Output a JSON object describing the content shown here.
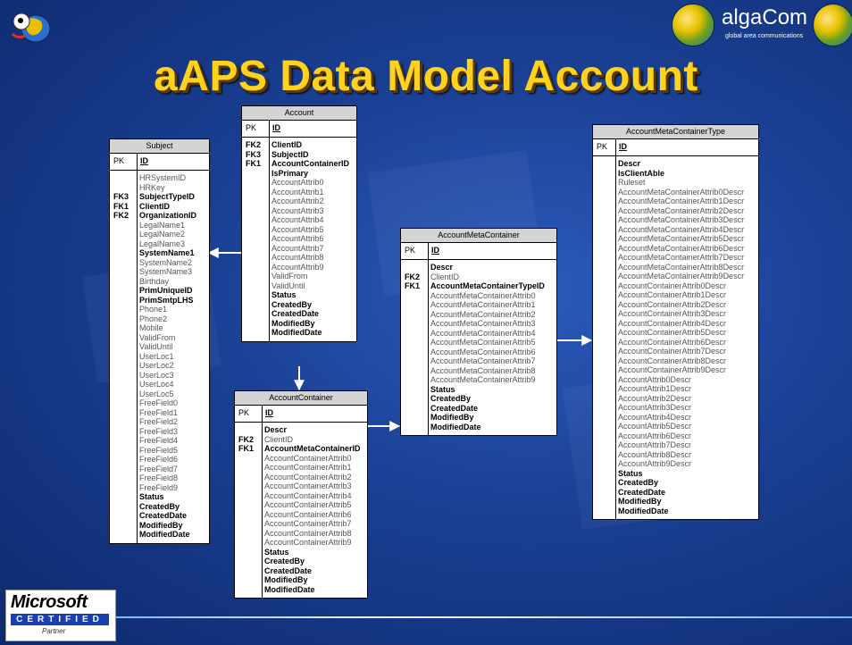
{
  "slide": {
    "title": "aAPS Data Model Account",
    "brand": {
      "name": "algaCom",
      "tagline": "global area communications"
    },
    "logo": {
      "word": "Microsoft",
      "certified": "CERTIFIED",
      "partner": "Partner"
    }
  },
  "tables": {
    "subject": {
      "name": "Subject",
      "pk_label": "PK",
      "pk_field": "ID",
      "fields": [
        {
          "key": "",
          "name": "HRSystemID",
          "bold": false
        },
        {
          "key": "",
          "name": "HRKey",
          "bold": false
        },
        {
          "key": "FK3",
          "name": "SubjectTypeID",
          "bold": true
        },
        {
          "key": "FK1",
          "name": "ClientID",
          "bold": true
        },
        {
          "key": "FK2",
          "name": "OrganizationID",
          "bold": true
        },
        {
          "key": "",
          "name": "LegalName1",
          "bold": false
        },
        {
          "key": "",
          "name": "LegalName2",
          "bold": false
        },
        {
          "key": "",
          "name": "LegalName3",
          "bold": false
        },
        {
          "key": "",
          "name": "SystemName1",
          "bold": true
        },
        {
          "key": "",
          "name": "SystemName2",
          "bold": false
        },
        {
          "key": "",
          "name": "SystemName3",
          "bold": false
        },
        {
          "key": "",
          "name": "Birthday",
          "bold": false
        },
        {
          "key": "",
          "name": "PrimUniqueID",
          "bold": true
        },
        {
          "key": "",
          "name": "PrimSmtpLHS",
          "bold": true
        },
        {
          "key": "",
          "name": "Phone1",
          "bold": false
        },
        {
          "key": "",
          "name": "Phone2",
          "bold": false
        },
        {
          "key": "",
          "name": "Mobile",
          "bold": false
        },
        {
          "key": "",
          "name": "ValidFrom",
          "bold": false
        },
        {
          "key": "",
          "name": "ValidUntil",
          "bold": false
        },
        {
          "key": "",
          "name": "UserLoc1",
          "bold": false
        },
        {
          "key": "",
          "name": "UserLoc2",
          "bold": false
        },
        {
          "key": "",
          "name": "UserLoc3",
          "bold": false
        },
        {
          "key": "",
          "name": "UserLoc4",
          "bold": false
        },
        {
          "key": "",
          "name": "UserLoc5",
          "bold": false
        },
        {
          "key": "",
          "name": "FreeField0",
          "bold": false
        },
        {
          "key": "",
          "name": "FreeField1",
          "bold": false
        },
        {
          "key": "",
          "name": "FreeField2",
          "bold": false
        },
        {
          "key": "",
          "name": "FreeField3",
          "bold": false
        },
        {
          "key": "",
          "name": "FreeField4",
          "bold": false
        },
        {
          "key": "",
          "name": "FreeField5",
          "bold": false
        },
        {
          "key": "",
          "name": "FreeField6",
          "bold": false
        },
        {
          "key": "",
          "name": "FreeField7",
          "bold": false
        },
        {
          "key": "",
          "name": "FreeField8",
          "bold": false
        },
        {
          "key": "",
          "name": "FreeField9",
          "bold": false
        },
        {
          "key": "",
          "name": "Status",
          "bold": true
        },
        {
          "key": "",
          "name": "CreatedBy",
          "bold": true
        },
        {
          "key": "",
          "name": "CreatedDate",
          "bold": true
        },
        {
          "key": "",
          "name": "ModifiedBy",
          "bold": true
        },
        {
          "key": "",
          "name": "ModifiedDate",
          "bold": true
        }
      ]
    },
    "account": {
      "name": "Account",
      "pk_label": "PK",
      "pk_field": "ID",
      "fields": [
        {
          "key": "FK2",
          "name": "ClientID",
          "bold": true
        },
        {
          "key": "FK3",
          "name": "SubjectID",
          "bold": true
        },
        {
          "key": "FK1",
          "name": "AccountContainerID",
          "bold": true
        },
        {
          "key": "",
          "name": "IsPrimary",
          "bold": true
        },
        {
          "key": "",
          "name": "AccountAttrib0",
          "bold": false
        },
        {
          "key": "",
          "name": "AccountAttrib1",
          "bold": false
        },
        {
          "key": "",
          "name": "AccountAttrib2",
          "bold": false
        },
        {
          "key": "",
          "name": "AccountAttrib3",
          "bold": false
        },
        {
          "key": "",
          "name": "AccountAttrib4",
          "bold": false
        },
        {
          "key": "",
          "name": "AccountAttrib5",
          "bold": false
        },
        {
          "key": "",
          "name": "AccountAttrib6",
          "bold": false
        },
        {
          "key": "",
          "name": "AccountAttrib7",
          "bold": false
        },
        {
          "key": "",
          "name": "AccountAttrib8",
          "bold": false
        },
        {
          "key": "",
          "name": "AccountAttrib9",
          "bold": false
        },
        {
          "key": "",
          "name": "ValidFrom",
          "bold": false
        },
        {
          "key": "",
          "name": "ValidUntil",
          "bold": false
        },
        {
          "key": "",
          "name": "Status",
          "bold": true
        },
        {
          "key": "",
          "name": "CreatedBy",
          "bold": true
        },
        {
          "key": "",
          "name": "CreatedDate",
          "bold": true
        },
        {
          "key": "",
          "name": "ModifiedBy",
          "bold": true
        },
        {
          "key": "",
          "name": "ModifiedDate",
          "bold": true
        }
      ]
    },
    "account_container": {
      "name": "AccountContainer",
      "pk_label": "PK",
      "pk_field": "ID",
      "fields": [
        {
          "key": "",
          "name": "Descr",
          "bold": true
        },
        {
          "key": "FK2",
          "name": "ClientID",
          "bold": false
        },
        {
          "key": "FK1",
          "name": "AccountMetaContainerID",
          "bold": true
        },
        {
          "key": "",
          "name": "AccountContainerAttrib0",
          "bold": false
        },
        {
          "key": "",
          "name": "AccountContainerAttrib1",
          "bold": false
        },
        {
          "key": "",
          "name": "AccountContainerAttrib2",
          "bold": false
        },
        {
          "key": "",
          "name": "AccountContainerAttrib3",
          "bold": false
        },
        {
          "key": "",
          "name": "AccountContainerAttrib4",
          "bold": false
        },
        {
          "key": "",
          "name": "AccountContainerAttrib5",
          "bold": false
        },
        {
          "key": "",
          "name": "AccountContainerAttrib6",
          "bold": false
        },
        {
          "key": "",
          "name": "AccountContainerAttrib7",
          "bold": false
        },
        {
          "key": "",
          "name": "AccountContainerAttrib8",
          "bold": false
        },
        {
          "key": "",
          "name": "AccountContainerAttrib9",
          "bold": false
        },
        {
          "key": "",
          "name": "Status",
          "bold": true
        },
        {
          "key": "",
          "name": "CreatedBy",
          "bold": true
        },
        {
          "key": "",
          "name": "CreatedDate",
          "bold": true
        },
        {
          "key": "",
          "name": "ModifiedBy",
          "bold": true
        },
        {
          "key": "",
          "name": "ModifiedDate",
          "bold": true
        }
      ]
    },
    "account_meta_container": {
      "name": "AccountMetaContainer",
      "pk_label": "PK",
      "pk_field": "ID",
      "fields": [
        {
          "key": "",
          "name": "Descr",
          "bold": true
        },
        {
          "key": "FK2",
          "name": "ClientID",
          "bold": false
        },
        {
          "key": "FK1",
          "name": "AccountMetaContainerTypeID",
          "bold": true
        },
        {
          "key": "",
          "name": "AccountMetaContainerAttrib0",
          "bold": false
        },
        {
          "key": "",
          "name": "AccountMetaContainerAttrib1",
          "bold": false
        },
        {
          "key": "",
          "name": "AccountMetaContainerAttrib2",
          "bold": false
        },
        {
          "key": "",
          "name": "AccountMetaContainerAttrib3",
          "bold": false
        },
        {
          "key": "",
          "name": "AccountMetaContainerAttrib4",
          "bold": false
        },
        {
          "key": "",
          "name": "AccountMetaContainerAttrib5",
          "bold": false
        },
        {
          "key": "",
          "name": "AccountMetaContainerAttrib6",
          "bold": false
        },
        {
          "key": "",
          "name": "AccountMetaContainerAttrib7",
          "bold": false
        },
        {
          "key": "",
          "name": "AccountMetaContainerAttrib8",
          "bold": false
        },
        {
          "key": "",
          "name": "AccountMetaContainerAttrib9",
          "bold": false
        },
        {
          "key": "",
          "name": "Status",
          "bold": true
        },
        {
          "key": "",
          "name": "CreatedBy",
          "bold": true
        },
        {
          "key": "",
          "name": "CreatedDate",
          "bold": true
        },
        {
          "key": "",
          "name": "ModifiedBy",
          "bold": true
        },
        {
          "key": "",
          "name": "ModifiedDate",
          "bold": true
        }
      ]
    },
    "account_meta_container_type": {
      "name": "AccountMetaContainerType",
      "pk_label": "PK",
      "pk_field": "ID",
      "fields": [
        {
          "key": "",
          "name": "Descr",
          "bold": true
        },
        {
          "key": "",
          "name": "IsClientAble",
          "bold": true
        },
        {
          "key": "",
          "name": "Ruleset",
          "bold": false
        },
        {
          "key": "",
          "name": "AccountMetaContainerAttrib0Descr",
          "bold": false
        },
        {
          "key": "",
          "name": "AccountMetaContainerAttrib1Descr",
          "bold": false
        },
        {
          "key": "",
          "name": "AccountMetaContainerAttrib2Descr",
          "bold": false
        },
        {
          "key": "",
          "name": "AccountMetaContainerAttrib3Descr",
          "bold": false
        },
        {
          "key": "",
          "name": "AccountMetaContainerAttrib4Descr",
          "bold": false
        },
        {
          "key": "",
          "name": "AccountMetaContainerAttrib5Descr",
          "bold": false
        },
        {
          "key": "",
          "name": "AccountMetaContainerAttrib6Descr",
          "bold": false
        },
        {
          "key": "",
          "name": "AccountMetaContainerAttrib7Descr",
          "bold": false
        },
        {
          "key": "",
          "name": "AccountMetaContainerAttrib8Descr",
          "bold": false
        },
        {
          "key": "",
          "name": "AccountMetaContainerAttrib9Descr",
          "bold": false
        },
        {
          "key": "",
          "name": "AccountContainerAttrib0Descr",
          "bold": false
        },
        {
          "key": "",
          "name": "AccountContainerAttrib1Descr",
          "bold": false
        },
        {
          "key": "",
          "name": "AccountContainerAttrib2Descr",
          "bold": false
        },
        {
          "key": "",
          "name": "AccountContainerAttrib3Descr",
          "bold": false
        },
        {
          "key": "",
          "name": "AccountContainerAttrib4Descr",
          "bold": false
        },
        {
          "key": "",
          "name": "AccountContainerAttrib5Descr",
          "bold": false
        },
        {
          "key": "",
          "name": "AccountContainerAttrib6Descr",
          "bold": false
        },
        {
          "key": "",
          "name": "AccountContainerAttrib7Descr",
          "bold": false
        },
        {
          "key": "",
          "name": "AccountContainerAttrib8Descr",
          "bold": false
        },
        {
          "key": "",
          "name": "AccountContainerAttrib9Descr",
          "bold": false
        },
        {
          "key": "",
          "name": "AccountAttrib0Descr",
          "bold": false
        },
        {
          "key": "",
          "name": "AccountAttrib1Descr",
          "bold": false
        },
        {
          "key": "",
          "name": "AccountAttrib2Descr",
          "bold": false
        },
        {
          "key": "",
          "name": "AccountAttrib3Descr",
          "bold": false
        },
        {
          "key": "",
          "name": "AccountAttrib4Descr",
          "bold": false
        },
        {
          "key": "",
          "name": "AccountAttrib5Descr",
          "bold": false
        },
        {
          "key": "",
          "name": "AccountAttrib6Descr",
          "bold": false
        },
        {
          "key": "",
          "name": "AccountAttrib7Descr",
          "bold": false
        },
        {
          "key": "",
          "name": "AccountAttrib8Descr",
          "bold": false
        },
        {
          "key": "",
          "name": "AccountAttrib9Descr",
          "bold": false
        },
        {
          "key": "",
          "name": "Status",
          "bold": true
        },
        {
          "key": "",
          "name": "CreatedBy",
          "bold": true
        },
        {
          "key": "",
          "name": "CreatedDate",
          "bold": true
        },
        {
          "key": "",
          "name": "ModifiedBy",
          "bold": true
        },
        {
          "key": "",
          "name": "ModifiedDate",
          "bold": true
        }
      ]
    }
  },
  "relationships": [
    {
      "from": "Account",
      "to": "Subject"
    },
    {
      "from": "Account",
      "to": "AccountContainer"
    },
    {
      "from": "AccountContainer",
      "to": "AccountMetaContainer"
    },
    {
      "from": "AccountMetaContainer",
      "to": "AccountMetaContainerType"
    }
  ],
  "colors": {
    "background": "#1a3f93",
    "title": "#ffd21c",
    "table_header": "#d4d4d4",
    "arrow": "#ffffff"
  }
}
